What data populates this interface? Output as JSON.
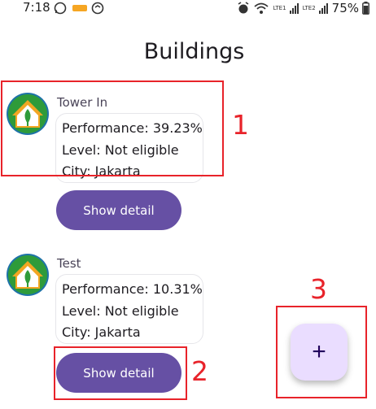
{
  "status_bar": {
    "time": "7:18",
    "battery_percent": "75%",
    "sim1_label": "LTE1",
    "sim2_label": "LTE2"
  },
  "header": {
    "title": "Buildings"
  },
  "buildings": [
    {
      "name": "Tower In",
      "performance": "Performance: 39.23%",
      "level": "Level: Not eligible",
      "city": "City: Jakarta",
      "button_label": "Show detail"
    },
    {
      "name": "Test",
      "performance": "Performance: 10.31%",
      "level": "Level: Not eligible",
      "city": "City: Jakarta",
      "button_label": "Show detail"
    }
  ],
  "fab": {
    "label": "+"
  },
  "annotations": {
    "one": "1",
    "two": "2",
    "three": "3"
  },
  "colors": {
    "accent": "#6650a4",
    "fab_bg": "#eaddff",
    "annotation": "#e8232a",
    "avatar_bg": "#1e73a8",
    "house_green": "#2e9b3a"
  },
  "icons": [
    "whatsapp-icon",
    "shopee-icon",
    "messenger-icon",
    "alarm-icon",
    "wifi-icon",
    "signal-icon",
    "battery-icon",
    "building-avatar-icon",
    "plus-icon"
  ]
}
